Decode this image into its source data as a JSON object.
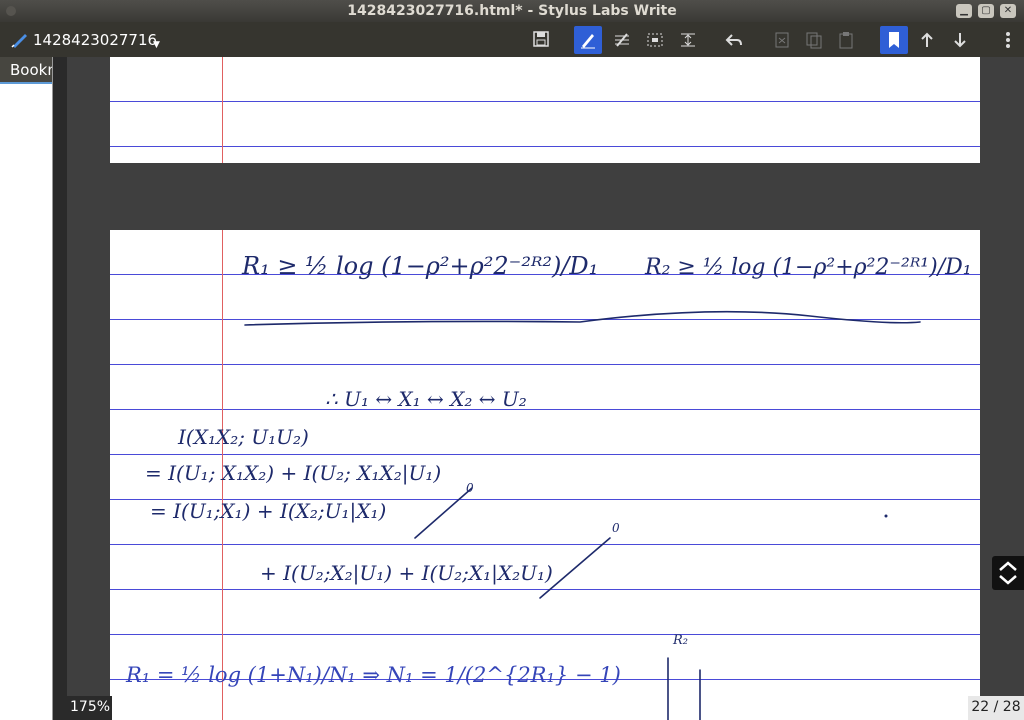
{
  "window": {
    "title": "1428423027716.html* - Stylus Labs Write",
    "buttons": {
      "minimize": "▁",
      "maximize": "▢",
      "close": "✕"
    }
  },
  "toolbar": {
    "doc_name": "1428423027716",
    "tools": [
      "save-icon",
      "pen-icon",
      "eraser-icon",
      "select-icon",
      "insert-space-icon",
      "undo-icon",
      "cut-icon",
      "copy-icon",
      "paste-icon",
      "bookmark-icon",
      "page-up-icon",
      "page-down-icon",
      "menu-icon"
    ],
    "accent": "#2f5fd6"
  },
  "sidebar": {
    "tab_label": "Bookmarks"
  },
  "status": {
    "zoom": "175%",
    "page": "22 / 28"
  },
  "notes": {
    "line1_left": "R₁ ≥ ½ log (1−ρ²+ρ²2⁻²ᴿ²)/D₁",
    "line1_right": "R₂ ≥ ½ log (1−ρ²+ρ²2⁻²ᴿ¹)/D₁",
    "markov": "∴ U₁ ↔ X₁ ↔ X₂ ↔ U₂",
    "mi_1": "I(X₁X₂; U₁U₂)",
    "mi_2": "= I(U₁; X₁X₂) + I(U₂; X₁X₂|U₁)",
    "mi_3": "= I(U₁;X₁) + I(X₂;U₁|X₁)",
    "mi_4": "+ I(U₂;X₂|U₁) + I(U₂;X₁|X₂U₁)",
    "zero_a": "0",
    "zero_b": "0",
    "bottom_eq": "R₁ = ½ log (1+N₁)/N₁ ⇒ N₁ = 1/(2^{2R₁} − 1)",
    "axis_label": "R₂"
  }
}
